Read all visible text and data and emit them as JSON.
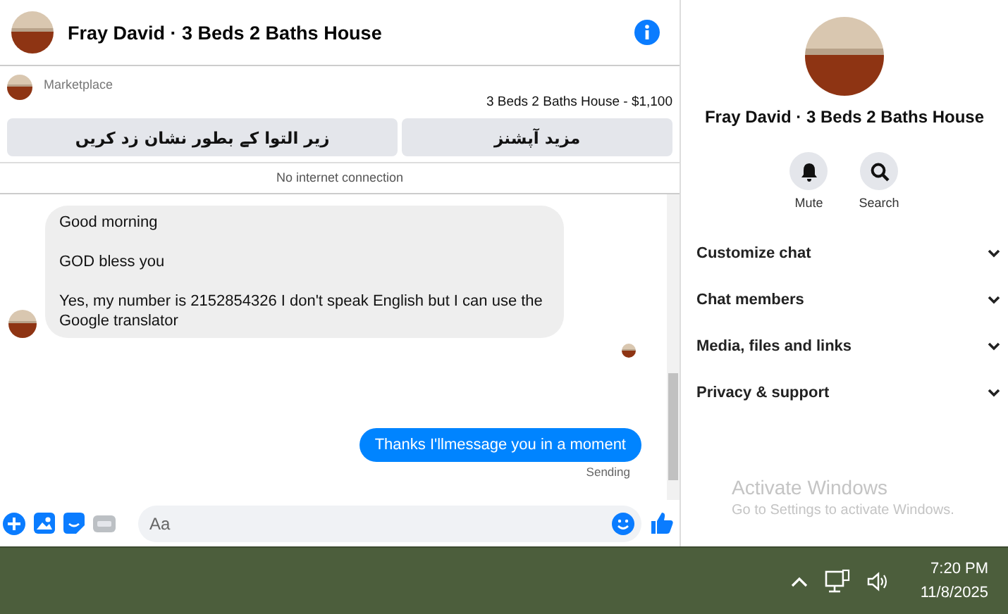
{
  "chat": {
    "title": "Fray David · 3 Beds 2 Baths House",
    "listing": {
      "source": "Marketplace",
      "title": "3 Beds 2 Baths House - $1,100",
      "actions": [
        "مزید آپشنز",
        "زیر التوا کے بطور نشان زد کریں"
      ]
    },
    "notice": "No internet connection",
    "messages": [
      {
        "kind": "received",
        "lines": [
          "Good morning",
          "GOD bless you",
          "Yes, my number is 2152854326 I don't speak English but I can use the Google translator"
        ]
      },
      {
        "kind": "sent",
        "lines": [
          "Thanks I'llmessage you in a moment"
        ],
        "status": "Sending"
      }
    ],
    "composer": {
      "placeholder": "Aa"
    }
  },
  "info_panel": {
    "title": "Fray David · 3 Beds 2 Baths House",
    "actions": [
      {
        "kind": "mute",
        "label": "Mute"
      },
      {
        "kind": "search",
        "label": "Search"
      }
    ],
    "sections": [
      {
        "label": "Customize chat",
        "expanded": false
      },
      {
        "label": "Chat members",
        "expanded": false
      },
      {
        "label": "Media, files and links",
        "expanded": false
      },
      {
        "label": "Privacy & support",
        "expanded": false
      }
    ]
  },
  "activation_notice": {
    "title": "Activate Windows",
    "text": "Go to Settings to activate Windows."
  },
  "taskbar": {
    "time": "7:20 PM",
    "date": "11/8/2025"
  }
}
